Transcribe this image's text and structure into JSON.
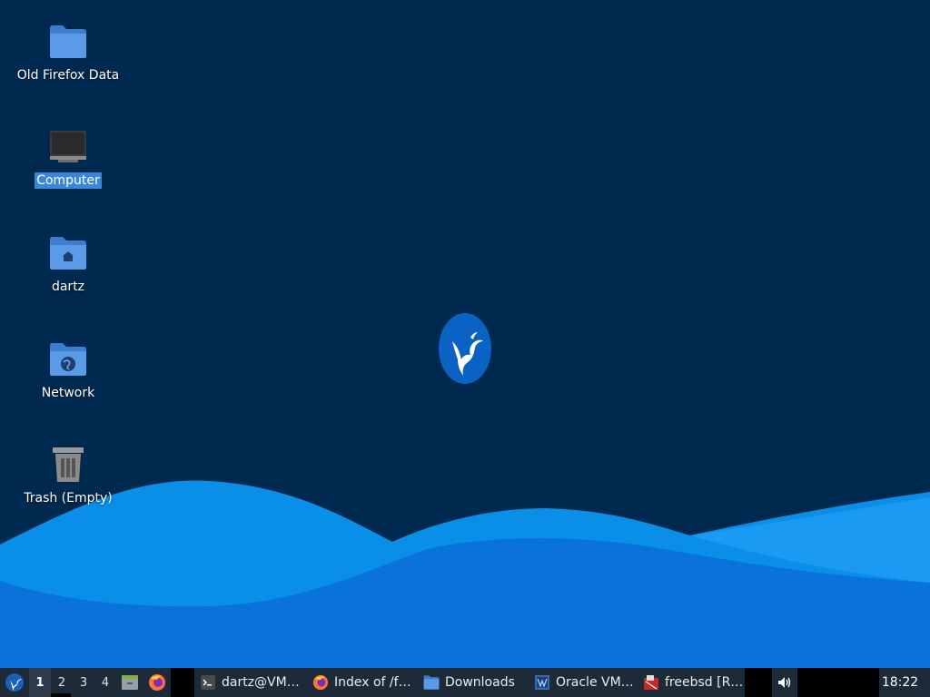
{
  "desktop": {
    "background_color": "#00294f",
    "icons": [
      {
        "label": "Old Firefox Data",
        "icon": "folder-icon"
      },
      {
        "label": "Computer",
        "icon": "computer-icon",
        "selected": true
      },
      {
        "label": "dartz",
        "icon": "home-folder-icon"
      },
      {
        "label": "Network",
        "icon": "network-folder-icon"
      },
      {
        "label": "Trash (Empty)",
        "icon": "trash-icon"
      }
    ],
    "logo": "hummingbird-logo-icon"
  },
  "taskbar": {
    "menu_icon": "xubuntu-menu-icon",
    "workspaces": [
      "1",
      "2",
      "3",
      "4"
    ],
    "active_workspace": "1",
    "launchers": [
      {
        "name": "file-manager-launcher",
        "icon": "file-cabinet-icon"
      },
      {
        "name": "firefox-launcher",
        "icon": "firefox-icon"
      }
    ],
    "tasks": [
      {
        "label": "dartz@VM…",
        "icon": "terminal-icon"
      },
      {
        "label": "Index of /f…",
        "icon": "firefox-icon"
      },
      {
        "label": "Downloads",
        "icon": "folder-icon"
      },
      {
        "label": "Oracle VM…",
        "icon": "virtualbox-icon"
      },
      {
        "label": "freebsd [R…",
        "icon": "vm-window-icon"
      }
    ],
    "volume_icon": "speaker-icon",
    "clock": "18:22"
  }
}
